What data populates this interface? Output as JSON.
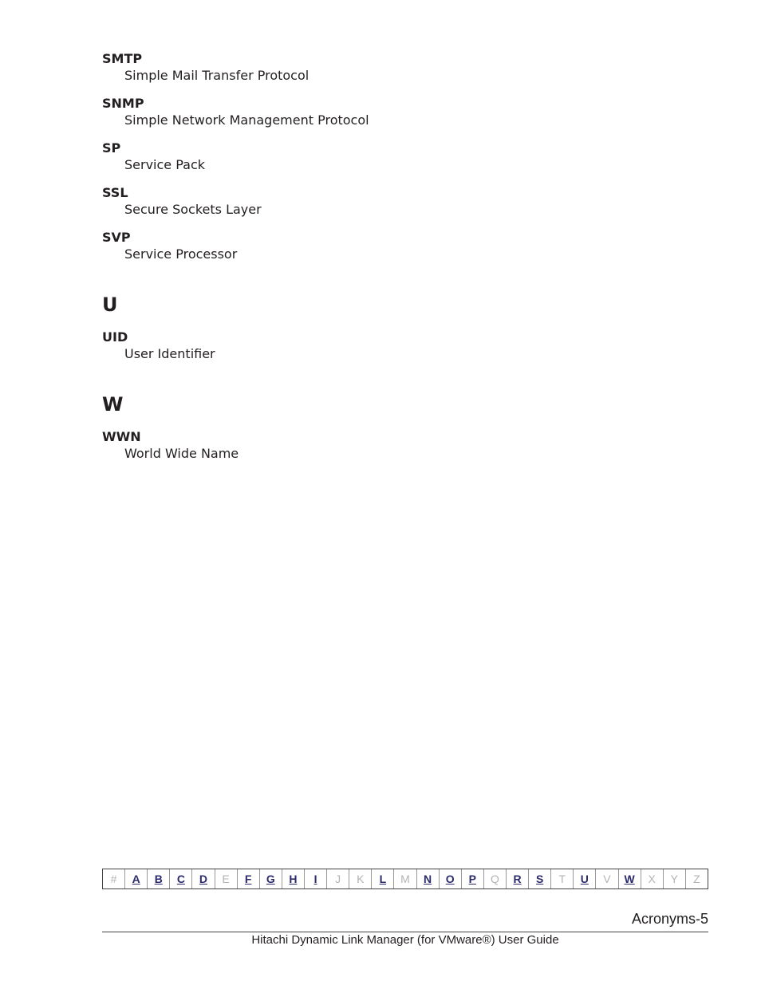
{
  "sections": [
    {
      "letter": "",
      "entries": [
        {
          "term": "SMTP",
          "definition": "Simple Mail Transfer Protocol"
        },
        {
          "term": "SNMP",
          "definition": "Simple Network Management Protocol"
        },
        {
          "term": "SP",
          "definition": "Service Pack"
        },
        {
          "term": "SSL",
          "definition": "Secure Sockets Layer"
        },
        {
          "term": "SVP",
          "definition": "Service Processor"
        }
      ]
    },
    {
      "letter": "U",
      "entries": [
        {
          "term": "UID",
          "definition": "User Identifier"
        }
      ]
    },
    {
      "letter": "W",
      "entries": [
        {
          "term": "WWN",
          "definition": "World Wide Name"
        }
      ]
    }
  ],
  "alpha_nav": [
    {
      "label": "#",
      "active": false
    },
    {
      "label": "A",
      "active": true
    },
    {
      "label": "B",
      "active": true
    },
    {
      "label": "C",
      "active": true
    },
    {
      "label": "D",
      "active": true
    },
    {
      "label": "E",
      "active": false
    },
    {
      "label": "F",
      "active": true
    },
    {
      "label": "G",
      "active": true
    },
    {
      "label": "H",
      "active": true
    },
    {
      "label": "I",
      "active": true
    },
    {
      "label": "J",
      "active": false
    },
    {
      "label": "K",
      "active": false
    },
    {
      "label": "L",
      "active": true
    },
    {
      "label": "M",
      "active": false
    },
    {
      "label": "N",
      "active": true
    },
    {
      "label": "O",
      "active": true
    },
    {
      "label": "P",
      "active": true
    },
    {
      "label": "Q",
      "active": false
    },
    {
      "label": "R",
      "active": true
    },
    {
      "label": "S",
      "active": true
    },
    {
      "label": "T",
      "active": false
    },
    {
      "label": "U",
      "active": true
    },
    {
      "label": "V",
      "active": false
    },
    {
      "label": "W",
      "active": true
    },
    {
      "label": "X",
      "active": false
    },
    {
      "label": "Y",
      "active": false
    },
    {
      "label": "Z",
      "active": false
    }
  ],
  "footer": {
    "page_number": "Acronyms-5",
    "document_title": "Hitachi Dynamic Link Manager (for VMware®) User Guide"
  },
  "colors": {
    "link": "#2b2b6b",
    "disabled": "#b3b3b3",
    "text": "#231f20"
  }
}
